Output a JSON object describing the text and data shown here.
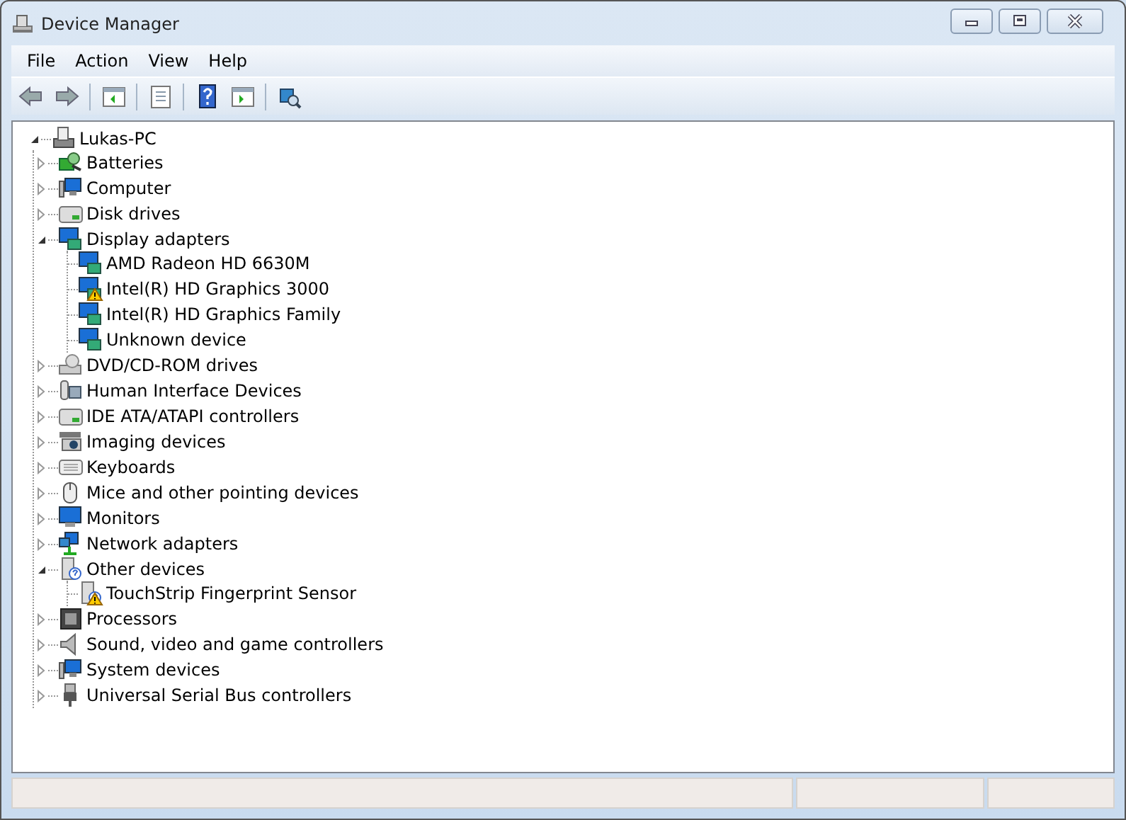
{
  "window": {
    "title": "Device Manager"
  },
  "menu": [
    "File",
    "Action",
    "View",
    "Help"
  ],
  "tree": {
    "label": "Lukas-PC",
    "kind": "pc",
    "expanded": true,
    "children": [
      {
        "label": "Batteries",
        "kind": "battery",
        "expanded": false
      },
      {
        "label": "Computer",
        "kind": "computer",
        "expanded": false
      },
      {
        "label": "Disk drives",
        "kind": "disk",
        "expanded": false
      },
      {
        "label": "Display adapters",
        "kind": "display",
        "expanded": true,
        "children": [
          {
            "label": "AMD Radeon HD 6630M",
            "kind": "display",
            "warning": false
          },
          {
            "label": "Intel(R) HD Graphics 3000",
            "kind": "display",
            "warning": true
          },
          {
            "label": "Intel(R) HD Graphics Family",
            "kind": "display",
            "warning": false
          },
          {
            "label": "Unknown device",
            "kind": "display",
            "warning": false
          }
        ]
      },
      {
        "label": "DVD/CD-ROM drives",
        "kind": "optical",
        "expanded": false
      },
      {
        "label": "Human Interface Devices",
        "kind": "hid",
        "expanded": false
      },
      {
        "label": "IDE ATA/ATAPI controllers",
        "kind": "disk",
        "expanded": false
      },
      {
        "label": "Imaging devices",
        "kind": "camera",
        "expanded": false
      },
      {
        "label": "Keyboards",
        "kind": "keyboard",
        "expanded": false
      },
      {
        "label": "Mice and other pointing devices",
        "kind": "mouse",
        "expanded": false
      },
      {
        "label": "Monitors",
        "kind": "monitor",
        "expanded": false
      },
      {
        "label": "Network adapters",
        "kind": "network",
        "expanded": false
      },
      {
        "label": "Other devices",
        "kind": "unknown",
        "expanded": true,
        "children": [
          {
            "label": "TouchStrip Fingerprint Sensor",
            "kind": "unknown",
            "warning": true
          }
        ]
      },
      {
        "label": "Processors",
        "kind": "chip",
        "expanded": false
      },
      {
        "label": "Sound, video and game controllers",
        "kind": "speaker",
        "expanded": false
      },
      {
        "label": "System devices",
        "kind": "computer",
        "expanded": false
      },
      {
        "label": "Universal Serial Bus controllers",
        "kind": "usb",
        "expanded": false
      }
    ]
  }
}
